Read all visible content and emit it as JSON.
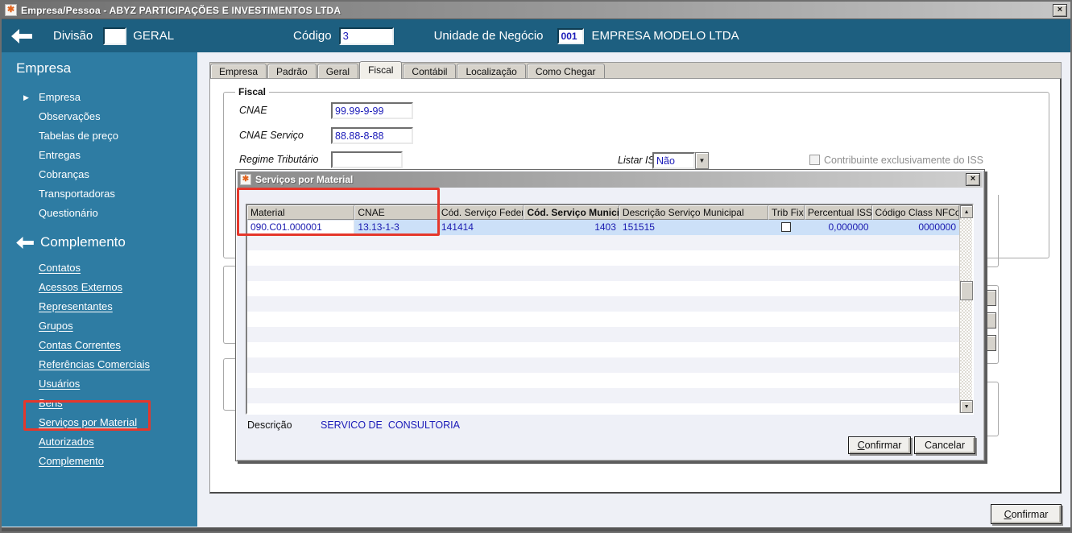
{
  "window": {
    "title": "Empresa/Pessoa - ABYZ PARTICIPAÇÕES E INVESTIMENTOS LTDA",
    "close_glyph": "×"
  },
  "header": {
    "division_label": "Divisão",
    "division_value": "",
    "division_name": "GERAL",
    "code_label": "Código",
    "code_value": "3",
    "unit_label": "Unidade de Negócio",
    "unit_code": "001",
    "unit_name": "EMPRESA MODELO LTDA"
  },
  "sidebar": {
    "section1": {
      "title": "Empresa",
      "items": [
        "Empresa",
        "Observações",
        "Tabelas de preço",
        "Entregas",
        "Cobranças",
        "Transportadoras",
        "Questionário"
      ]
    },
    "section2": {
      "title": "Complemento",
      "items": [
        "Contatos",
        "Acessos Externos",
        "Representantes",
        "Grupos",
        "Contas Correntes",
        "Referências Comerciais",
        "Usuários",
        "Bens",
        "Serviços por Material",
        "Autorizados",
        "Complemento"
      ]
    }
  },
  "tabs": {
    "items": [
      "Empresa",
      "Padrão",
      "Geral",
      "Fiscal",
      "Contábil",
      "Localização",
      "Como Chegar"
    ],
    "active": "Fiscal"
  },
  "fiscal_form": {
    "group_title": "Fiscal",
    "cnae_label": "CNAE",
    "cnae_value": "99.99-9-99",
    "cnae_servico_label": "CNAE Serviço",
    "cnae_servico_value": "88.88-8-88",
    "regime_label": "Regime Tributário",
    "regime_value": "",
    "listar_iss_label": "Listar  ISS",
    "listar_iss_value": "Não",
    "iss_checkbox_label": "Contribuinte exclusivamente do ISS"
  },
  "modal": {
    "title": "Serviços por Material",
    "close_glyph": "×",
    "columns": [
      "Material",
      "CNAE",
      "Cód. Serviço Federal",
      "Cód. Serviço Municipal",
      "Descrição Serviço Municipal",
      "Trib Fixa",
      "Percentual ISS",
      "Código Class NFCom"
    ],
    "row": {
      "material": "090.C01.000001",
      "cnae": "13.13-1-3",
      "cod_servico_federal": "141414",
      "cod_servico_municipal": "1403",
      "descricao_servico_municipal": "151515",
      "trib_fixa_checked": false,
      "percentual_iss": "0,000000",
      "codigo_class_nfcom": "0000000"
    },
    "descricao_label": "Descrição",
    "descricao_value": "SERVICO DE  CONSULTORIA",
    "confirm_label": "Confirmar",
    "cancel_label": "Cancelar"
  },
  "footer": {
    "confirm_label": "Confirmar"
  },
  "colors": {
    "header_teal": "#1d5f80",
    "sidebar_teal": "#2e7ca3",
    "window_bg": "#eef0f6",
    "annotation_red": "#e5372b",
    "selected_row_blue": "#cce0f8",
    "value_text_blue": "#1a1ab8",
    "titlebar_gray": "#8c8c8c"
  }
}
